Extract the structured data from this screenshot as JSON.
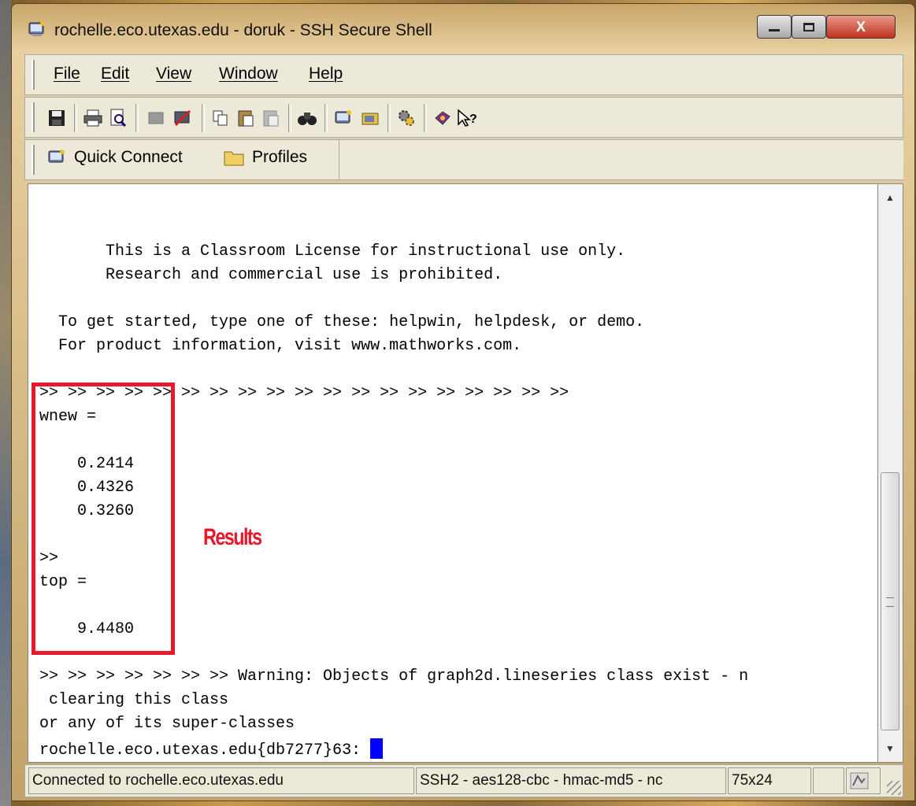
{
  "window": {
    "title": "rochelle.eco.utexas.edu - doruk - SSH Secure Shell",
    "controls": {
      "minimize": "‒",
      "maximize": "☐",
      "close": "X"
    }
  },
  "menu": {
    "items": [
      {
        "label": "File"
      },
      {
        "label": "Edit"
      },
      {
        "label": "View"
      },
      {
        "label": "Window"
      },
      {
        "label": "Help"
      }
    ]
  },
  "toolbar": {
    "icons": [
      "save-icon",
      "print-icon",
      "print-preview-icon",
      "disconnect-icon",
      "new-connection-icon",
      "copy-icon",
      "paste-icon",
      "paste-disabled-icon",
      "find-icon",
      "new-terminal-icon",
      "new-file-transfer-icon",
      "settings-icon",
      "help-book-icon",
      "context-help-icon"
    ]
  },
  "connection_bar": {
    "quick_connect_label": "Quick Connect",
    "profiles_label": "Profiles"
  },
  "terminal": {
    "lines": [
      "       This is a Classroom License for instructional use only.",
      "       Research and commercial use is prohibited.",
      "",
      "  To get started, type one of these: helpwin, helpdesk, or demo.",
      "  For product information, visit www.mathworks.com.",
      "",
      ">> >> >> >> >> >> >> >> >> >> >> >> >> >> >> >> >> >> >>",
      "wnew =",
      "",
      "    0.2414",
      "    0.4326",
      "    0.3260",
      "",
      "",
      ">>",
      "top =",
      "",
      "    9.4480",
      "",
      ">> >> >> >> >> >> >> Warning: Objects of graph2d.lineseries class exist - n",
      " clearing this class",
      "or any of its super-classes",
      "rochelle.eco.utexas.edu{db7277}63: "
    ]
  },
  "annotation": {
    "text": "Results",
    "color": "#e8192c"
  },
  "status": {
    "connection": "Connected to rochelle.eco.utexas.edu",
    "cipher": "SSH2 - aes128-cbc - hmac-md5 - nc",
    "size": "75x24"
  }
}
